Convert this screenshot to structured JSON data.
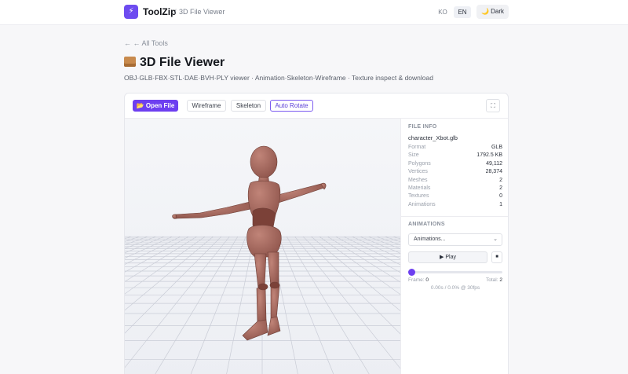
{
  "header": {
    "logo_glyph": "⚡",
    "brand": "ToolZip",
    "breadcrumb_sep": "/",
    "breadcrumb": "3D File Viewer",
    "lang_ko": "KO",
    "lang_en": "EN",
    "theme_toggle": "🌙 Dark"
  },
  "page": {
    "back_link": "← ← All Tools",
    "title": "3D File Viewer",
    "subtitle": "OBJ·GLB·FBX·STL·DAE·BVH·PLY viewer · Animation·Skeleton·Wireframe · Texture inspect & download"
  },
  "toolbar": {
    "open_file": "📂 Open File",
    "wireframe": "Wireframe",
    "skeleton": "Skeleton",
    "auto_rotate": "Auto Rotate",
    "fullscreen_glyph": "⛶"
  },
  "file_info": {
    "section_title": "FILE INFO",
    "filename": "character_Xbot.glb",
    "rows": [
      {
        "label": "Format",
        "value": "GLB"
      },
      {
        "label": "Size",
        "value": "1792.5 KB"
      },
      {
        "label": "Polygons",
        "value": "49,112"
      },
      {
        "label": "Vertices",
        "value": "28,374"
      },
      {
        "label": "Meshes",
        "value": "2"
      },
      {
        "label": "Materials",
        "value": "2"
      },
      {
        "label": "Textures",
        "value": "0"
      },
      {
        "label": "Animations",
        "value": "1"
      }
    ]
  },
  "animations": {
    "section_title": "ANIMATIONS",
    "select_value": "Animations...",
    "play_label": "▶ Play",
    "stop_glyph": "■",
    "progress": 0,
    "frame_label": "Frame:",
    "frame_value": "0",
    "total_label": "Total:",
    "total_value": "2",
    "time_text": "0.00s / 0.0% @ 30fps"
  },
  "colors": {
    "accent": "#6d3ff0",
    "model": "#a2665d"
  }
}
